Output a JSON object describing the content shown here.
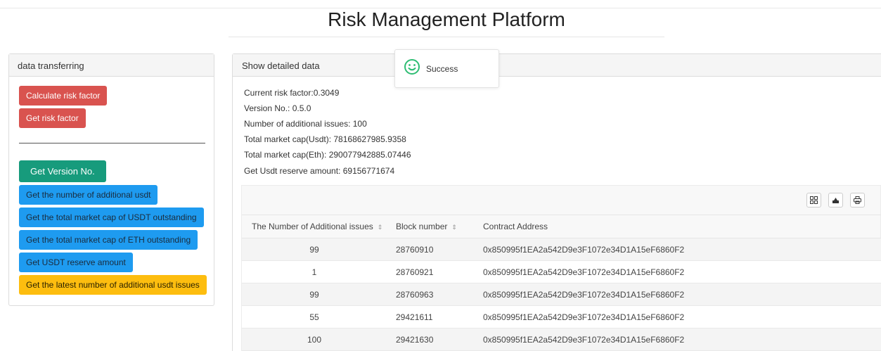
{
  "header": {
    "title": "Risk Management Platform"
  },
  "left_panel": {
    "heading": "data transferring",
    "buttons": {
      "calculate_risk_factor": "Calculate risk factor",
      "get_risk_factor": "Get risk factor",
      "get_version": "Get Version No.",
      "get_additional_usdt": "Get the number of additional usdt",
      "get_usdt_market_cap": "Get the total market cap of USDT outstanding",
      "get_eth_market_cap": "Get the total market cap of ETH outstanding",
      "get_usdt_reserve": "Get USDT reserve amount",
      "get_latest_additional": "Get the latest number of additional usdt issues"
    }
  },
  "right_panel": {
    "heading": "Show detailed data",
    "info": {
      "risk_factor": "Current risk factor:0.3049",
      "version": "Version No.: 0.5.0",
      "additional_issues": "Number of additional issues: 100",
      "market_cap_usdt": "Total market cap(Usdt): 78168627985.9358",
      "market_cap_eth": "Total market cap(Eth): 290077942885.07446",
      "usdt_reserve": "Get Usdt reserve amount: 69156771674"
    },
    "table": {
      "columns": [
        "The Number of Additional issues",
        "Block number",
        "Contract Address"
      ],
      "rows": [
        [
          "99",
          "28760910",
          "0x850995f1EA2a542D9e3F1072e34D1A15eF6860F2"
        ],
        [
          "1",
          "28760921",
          "0x850995f1EA2a542D9e3F1072e34D1A15eF6860F2"
        ],
        [
          "99",
          "28760963",
          "0x850995f1EA2a542D9e3F1072e34D1A15eF6860F2"
        ],
        [
          "55",
          "29421611",
          "0x850995f1EA2a542D9e3F1072e34D1A15eF6860F2"
        ],
        [
          "100",
          "29421630",
          "0x850995f1EA2a542D9e3F1072e34D1A15eF6860F2"
        ]
      ],
      "toolbar_icons": [
        "columns-icon",
        "export-icon",
        "print-icon"
      ]
    }
  },
  "toast": {
    "message": "Success",
    "icon": "smile-icon",
    "color": "#2ebd73"
  }
}
